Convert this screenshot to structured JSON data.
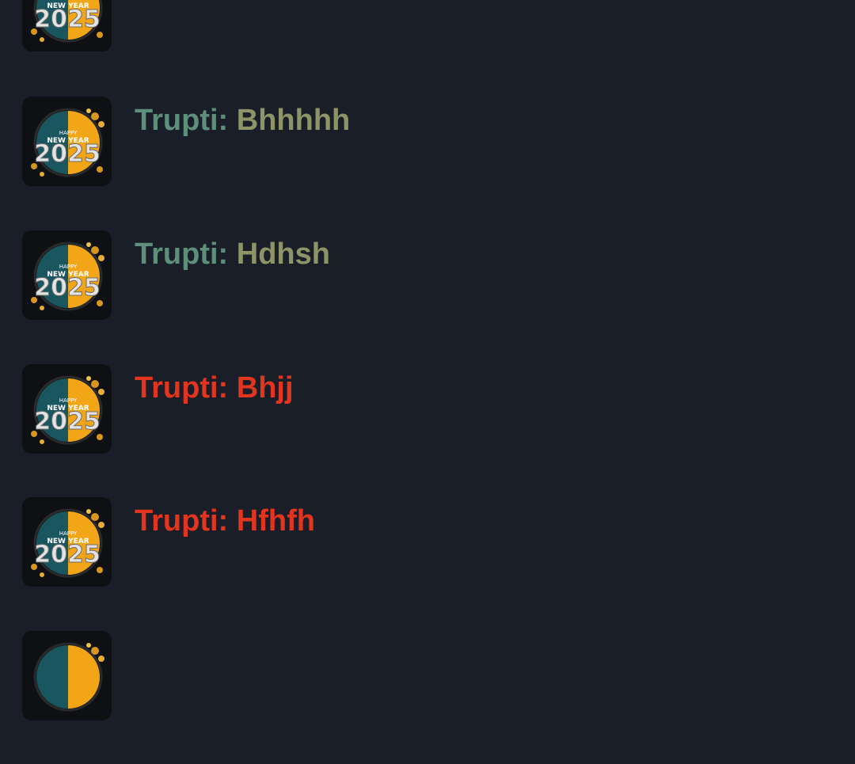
{
  "chat_list": {
    "items": [
      {
        "sender": "",
        "message": "",
        "state": "partially visible (cut off at top)"
      },
      {
        "sender": "Trupti:",
        "message": "Bhhhhh",
        "state": "muted"
      },
      {
        "sender": "Trupti:",
        "message": "Hdhsh",
        "state": "muted"
      },
      {
        "sender": "Trupti:",
        "message": "Bhjj",
        "state": "highlighted"
      },
      {
        "sender": "Trupti:",
        "message": "Hfhfh",
        "state": "highlighted"
      },
      {
        "sender": "",
        "message": "",
        "state": "partially visible (cut off at bottom)"
      }
    ],
    "thumbnail": {
      "top_text": "HAPPY",
      "mid_text": "NEW YEAR",
      "year": "2025"
    }
  },
  "colors": {
    "background": "#191e28",
    "sender_muted": "#5e8f7a",
    "message_muted": "#8f9467",
    "highlight_red": "#e2351f"
  }
}
